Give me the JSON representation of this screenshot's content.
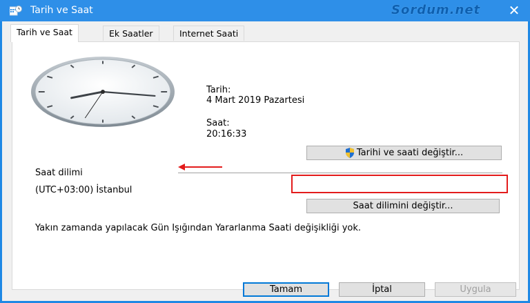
{
  "window": {
    "title": "Tarih ve Saat",
    "watermark": "Sordum.net",
    "close_glyph": "✕"
  },
  "tabs": [
    {
      "label": "Tarih ve Saat",
      "active": true
    },
    {
      "label": "Ek Saatler",
      "active": false
    },
    {
      "label": "Internet Saati",
      "active": false
    }
  ],
  "date": {
    "label": "Tarih:",
    "value": "4 Mart 2019 Pazartesi"
  },
  "time": {
    "label": "Saat:",
    "value": "20:16:33",
    "hour": 20,
    "minute": 16,
    "second": 33
  },
  "change_datetime_button": "Tarihi ve saati değiştir...",
  "timezone": {
    "label": "Saat dilimi",
    "value": "(UTC+03:00) İstanbul",
    "change_button": "Saat dilimini değiştir..."
  },
  "dst_note": "Yakın zamanda yapılacak Gün Işığından Yararlanma Saati değişikliği yok.",
  "footer": {
    "ok": "Tamam",
    "cancel": "İptal",
    "apply": "Uygula"
  },
  "colors": {
    "titlebar": "#2e8fe8",
    "highlight_box": "#e31b1b",
    "annotation_arrow": "#e31b1b"
  },
  "icons": {
    "window": "date-time-control-panel-icon",
    "uac": "uac-shield-icon"
  }
}
